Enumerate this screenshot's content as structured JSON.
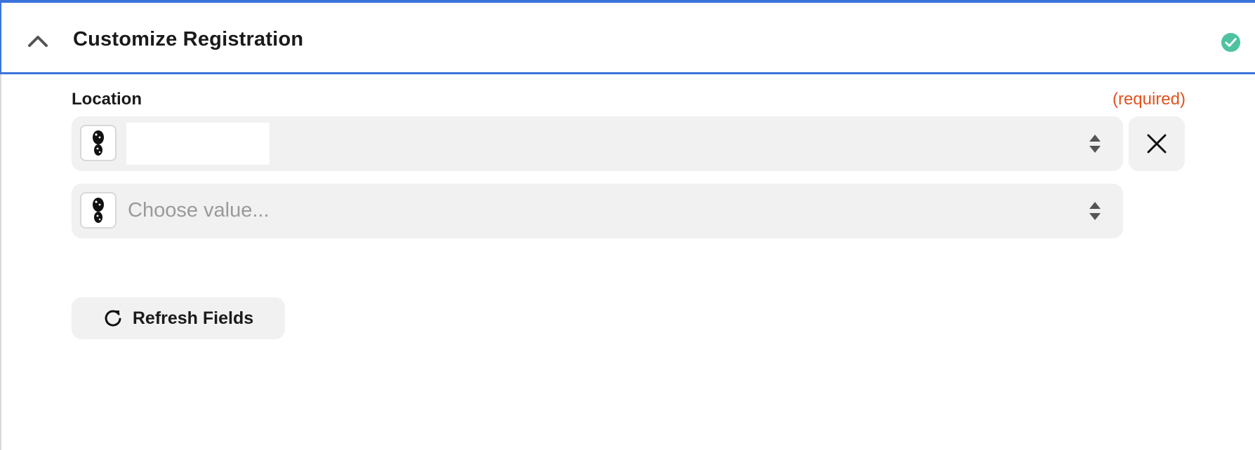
{
  "section": {
    "title": "Customize Registration",
    "status": "complete",
    "accent_color": "#3b73db",
    "status_color": "#4fc3a1",
    "icons": {
      "collapse": "chevron-up-icon",
      "status": "check-circle-icon"
    }
  },
  "field": {
    "label": "Location",
    "required_text": "(required)",
    "required_color": "#e2521d",
    "rows": [
      {
        "value": "",
        "app_icon": "footprint-icon",
        "control": "up-down-stepper-icon"
      },
      {
        "placeholder": "Choose value...",
        "app_icon": "footprint-icon",
        "control": "up-down-stepper-icon"
      }
    ],
    "clear_icon": "close-icon"
  },
  "actions": {
    "refresh_label": "Refresh Fields",
    "refresh_icon": "refresh-icon"
  }
}
